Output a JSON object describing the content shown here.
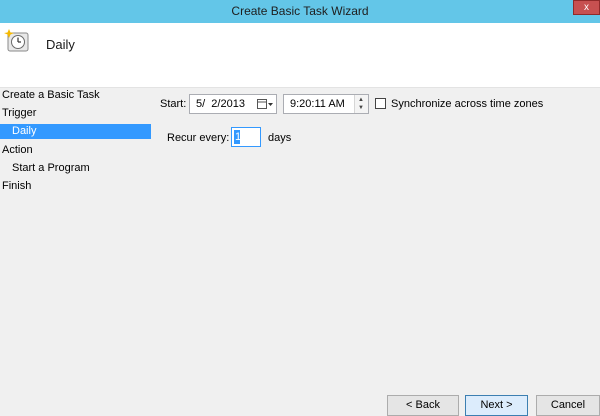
{
  "window": {
    "title": "Create Basic Task Wizard",
    "close_glyph": "x"
  },
  "header": {
    "title": "Daily",
    "icon": "task-clock-icon"
  },
  "nav": {
    "items": [
      {
        "label": "Create a Basic Task",
        "selected": false
      },
      {
        "label": "Trigger",
        "selected": false
      },
      {
        "label": "Daily",
        "selected": true
      },
      {
        "label": "Action",
        "selected": false
      },
      {
        "label": "Start a Program",
        "selected": false
      },
      {
        "label": "Finish",
        "selected": false
      }
    ]
  },
  "trigger": {
    "start_label": "Start:",
    "start_date": "5/  2/2013",
    "start_time": "9:20:11 AM",
    "sync_label": "Synchronize across time zones",
    "sync_checked": false,
    "recur_label": "Recur every:",
    "recur_value": "1",
    "recur_unit": "days"
  },
  "buttons": {
    "back": "< Back",
    "next": "Next >",
    "cancel": "Cancel"
  },
  "colors": {
    "titlebar": "#63c6e8",
    "selection": "#3399ff",
    "close": "#c75050"
  }
}
